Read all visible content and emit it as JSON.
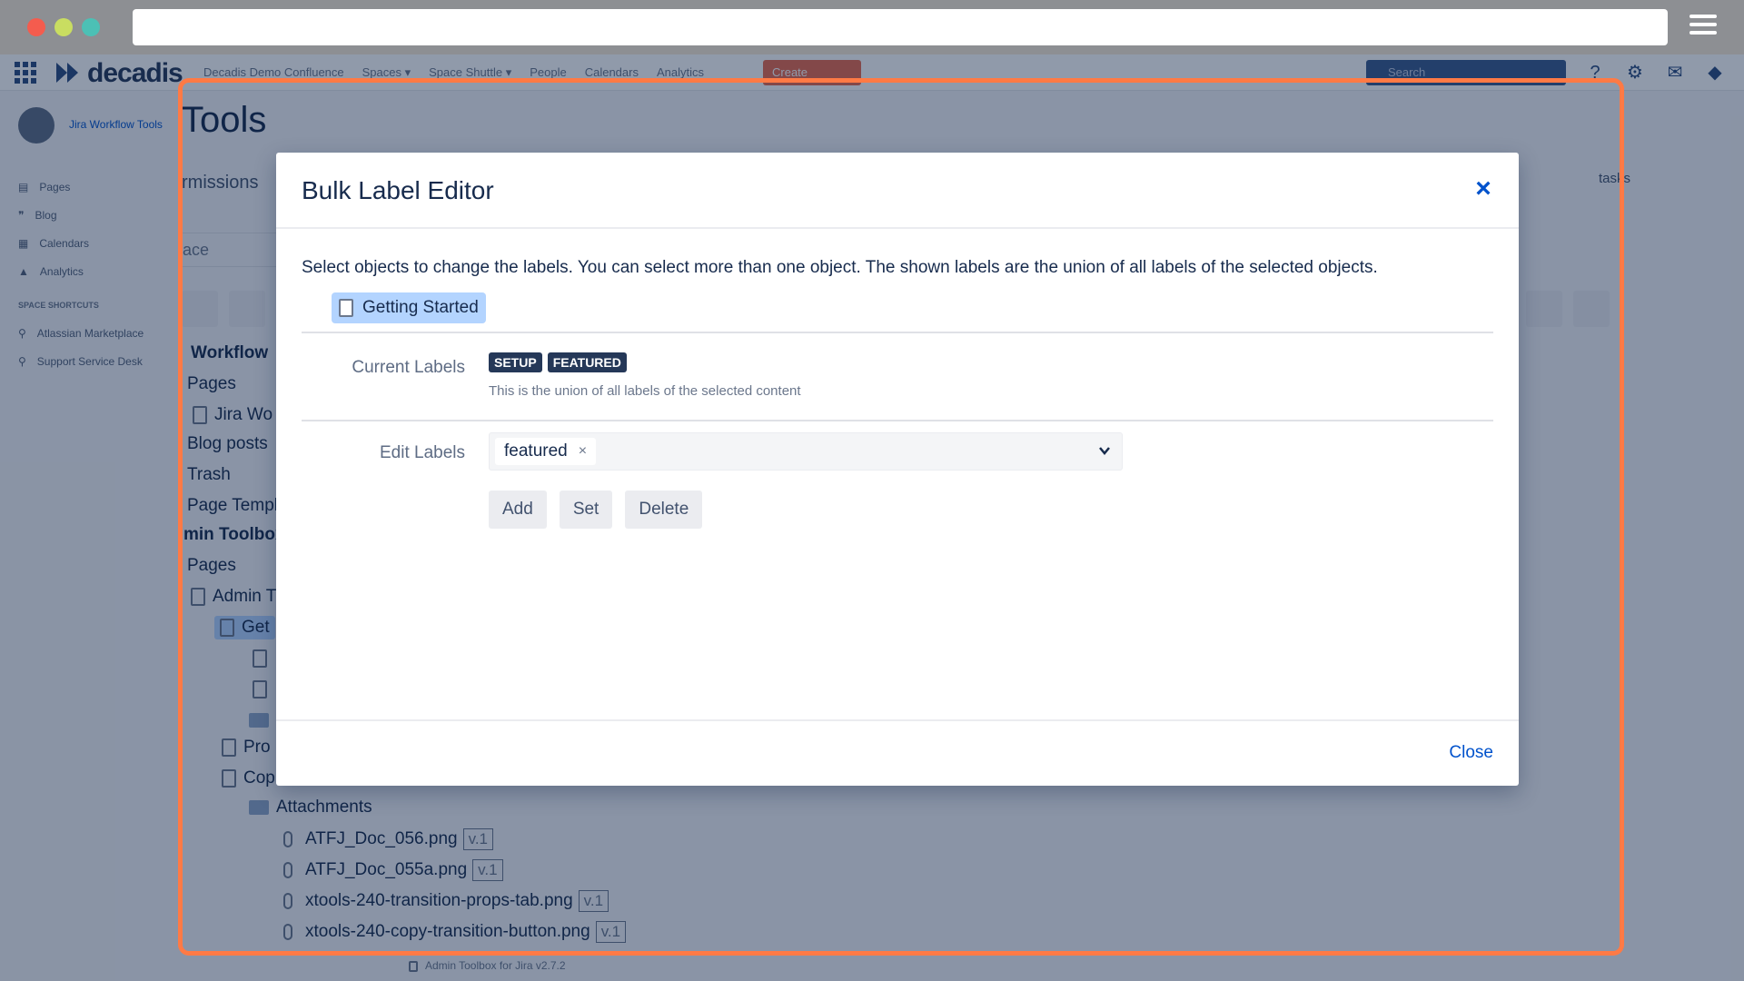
{
  "browser": {
    "address": ""
  },
  "topnav": {
    "logo": "decadis",
    "links": [
      "Decadis Demo Confluence",
      "Spaces ▾",
      "Space Shuttle ▾",
      "People",
      "Calendars",
      "Analytics"
    ],
    "create": "Create",
    "search_placeholder": "Search"
  },
  "sidebar": {
    "space_name": "Jira Workflow Tools",
    "items": [
      "Pages",
      "Blog",
      "Calendars",
      "Analytics"
    ],
    "shortcuts_heading": "SPACE SHORTCUTS",
    "shortcuts": [
      "Atlassian Marketplace",
      "Support Service Desk"
    ]
  },
  "background": {
    "title": "Tools",
    "tab": "rmissions",
    "right_tab": "tasks",
    "filter": "ace",
    "tree": {
      "workflow": "Workflow",
      "pages1": "Pages",
      "jira": "Jira Wo",
      "blog": "Blog posts",
      "trash": "Trash",
      "page_templates": "Page Templ",
      "admin_toolbox": "min Toolbox",
      "pages2": "Pages",
      "admin": "Admin T",
      "get": "Get",
      "pro": "Pro",
      "copy": "Cop",
      "attachments": "Attachments",
      "files": [
        {
          "name": "ATFJ_Doc_056.png",
          "version": "v.1"
        },
        {
          "name": "ATFJ_Doc_055a.png",
          "version": "v.1"
        },
        {
          "name": "xtools-240-transition-props-tab.png",
          "version": "v.1"
        },
        {
          "name": "xtools-240-copy-transition-button.png",
          "version": "v.1"
        }
      ],
      "footer_item": "Admin Toolbox for Jira v2.7.2"
    }
  },
  "modal": {
    "title": "Bulk Label Editor",
    "intro": "Select objects to change the labels. You can select more than one object. The shown labels are the union of all labels of the selected objects.",
    "selected_object": "Getting Started",
    "current_labels_label": "Current Labels",
    "current_labels": [
      "SETUP",
      "FEATURED"
    ],
    "current_labels_help": "This is the union of all labels of the selected content",
    "edit_labels_label": "Edit Labels",
    "edit_tags": [
      "featured"
    ],
    "tag_remove": "×",
    "buttons": {
      "add": "Add",
      "set": "Set",
      "delete": "Delete"
    },
    "close_x": "×",
    "footer_close": "Close"
  }
}
